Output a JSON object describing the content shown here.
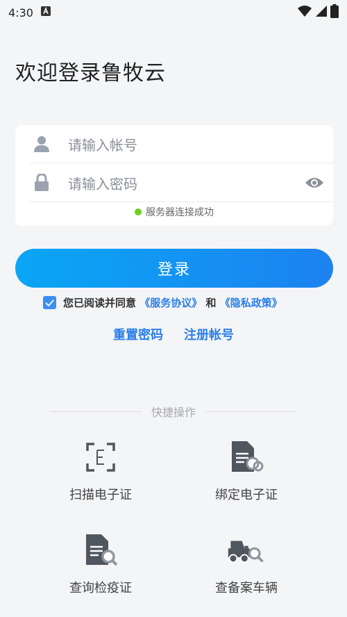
{
  "status_bar": {
    "time": "4:30"
  },
  "welcome_title": "欢迎登录鲁牧云",
  "form": {
    "account_placeholder": "请输入帐号",
    "password_placeholder": "请输入密码",
    "server_status": "服务器连接成功",
    "server_status_color": "#6fd123"
  },
  "login_button": "登录",
  "agreement": {
    "checked": true,
    "prefix": "您已阅读并同意",
    "service_link": "《服务协议》",
    "and": "和",
    "privacy_link": "《隐私政策》"
  },
  "links": {
    "reset_password": "重置密码",
    "register": "注册帐号"
  },
  "quick_ops": {
    "title": "快捷操作",
    "items": [
      {
        "label": "扫描电子证",
        "icon": "scan-e-certificate-icon"
      },
      {
        "label": "绑定电子证",
        "icon": "bind-document-icon"
      },
      {
        "label": "查询检疫证",
        "icon": "search-document-icon"
      },
      {
        "label": "查备案车辆",
        "icon": "search-truck-icon"
      }
    ]
  },
  "colors": {
    "accent": "#2a7fe8",
    "button_start": "#0aa6f5",
    "button_end": "#1c82f0"
  }
}
